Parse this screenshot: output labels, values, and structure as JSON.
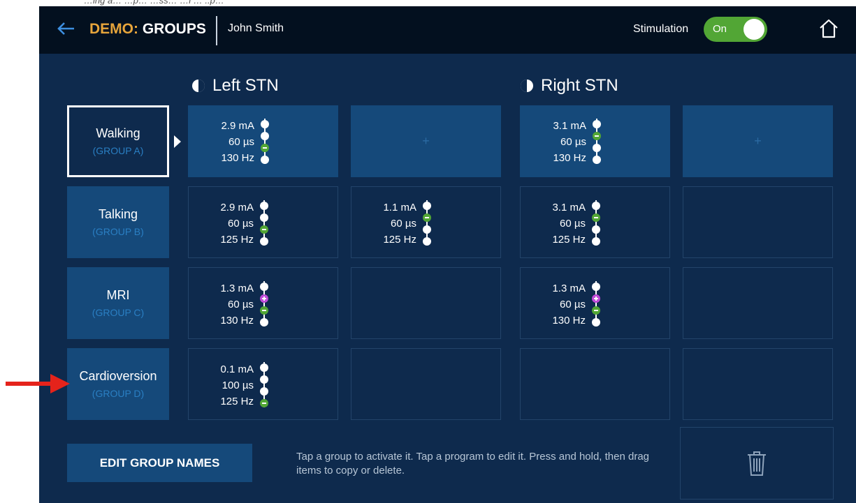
{
  "caption": "…ing a…  …p…   …ss…   …l … ..p…",
  "header": {
    "title_accent": "DEMO:",
    "title_main": " GROUPS",
    "patient_name": "John Smith",
    "stimulation_label": "Stimulation",
    "stimulation_toggle": "On"
  },
  "columns": {
    "left": "Left STN",
    "right": "Right STN"
  },
  "groups": [
    {
      "name": "Walking",
      "sub": "(GROUP A)"
    },
    {
      "name": "Talking",
      "sub": "(GROUP B)"
    },
    {
      "name": "MRI",
      "sub": "(GROUP C)"
    },
    {
      "name": "Cardioversion",
      "sub": "(GROUP D)"
    }
  ],
  "programs": {
    "a1": {
      "amp": "2.9 mA",
      "pw": "60 µs",
      "freq": "130 Hz"
    },
    "a3": {
      "amp": "3.1 mA",
      "pw": "60 µs",
      "freq": "130 Hz"
    },
    "b1": {
      "amp": "2.9 mA",
      "pw": "60 µs",
      "freq": "125 Hz"
    },
    "b2": {
      "amp": "1.1 mA",
      "pw": "60 µs",
      "freq": "125 Hz"
    },
    "b3": {
      "amp": "3.1 mA",
      "pw": "60 µs",
      "freq": "125 Hz"
    },
    "c1": {
      "amp": "1.3 mA",
      "pw": "60 µs",
      "freq": "130 Hz"
    },
    "c3": {
      "amp": "1.3 mA",
      "pw": "60 µs",
      "freq": "130 Hz"
    },
    "d1": {
      "amp": "0.1 mA",
      "pw": "100 µs",
      "freq": "125 Hz"
    }
  },
  "add_symbol": "+",
  "edit_button": "EDIT GROUP NAMES",
  "hint": "Tap a group to activate it. Tap a program to edit it. Press and hold, then drag items to copy or delete.",
  "colors": {
    "accent": "#e7a53b",
    "toggle_on": "#52a635",
    "contact_cathode": "#52a635",
    "contact_anode": "#c04ad8",
    "annotation_arrow": "#e5231b"
  },
  "icons": [
    "back-arrow-icon",
    "home-icon",
    "half-circle-icon",
    "play-pointer-icon",
    "lead-contacts-icon",
    "trash-icon",
    "red-arrow-icon"
  ]
}
